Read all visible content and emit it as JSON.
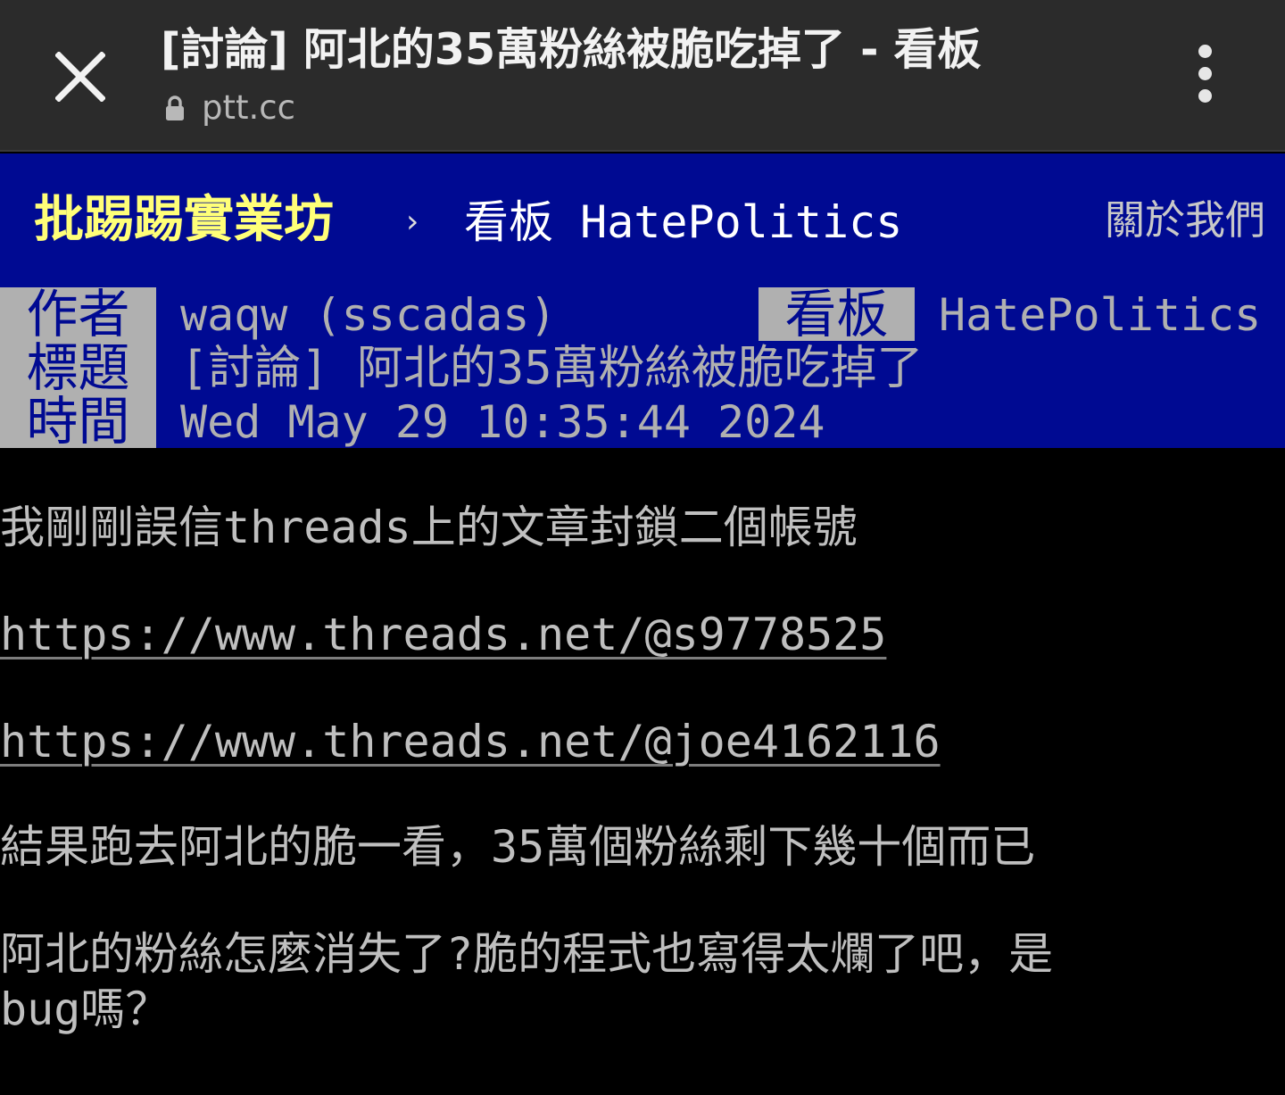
{
  "browser": {
    "title": "[討論] 阿北的35萬粉絲被脆吃掉了 - 看板",
    "url": "ptt.cc"
  },
  "site_nav": {
    "logo": "批踢踢實業坊",
    "separator": "›",
    "board_label": "看板 HatePolitics",
    "about": "關於我們"
  },
  "article_meta": {
    "author_label": "作者",
    "author": "waqw (sscadas)",
    "board_label": "看板",
    "board": "HatePolitics",
    "title_label": "標題",
    "title": "[討論] 阿北的35萬粉絲被脆吃掉了",
    "time_label": "時間",
    "time": "Wed May 29 10:35:44 2024"
  },
  "content": {
    "line1": "我剛剛誤信threads上的文章封鎖二個帳號",
    "link1": "https://www.threads.net/@s9778525",
    "link2": "https://www.threads.net/@joe4162116",
    "line2": "結果跑去阿北的脆一看，35萬個粉絲剩下幾十個而已",
    "line3": "阿北的粉絲怎麼消失了?脆的程式也寫得太爛了吧，是",
    "line4": "bug嗎？"
  },
  "colors": {
    "browser_bar": "#2b2b2b",
    "nav_bg": "#000a92",
    "logo": "#ffff78",
    "meta_tag_bg": "#b0b0b0",
    "text": "#bfbfbf"
  }
}
